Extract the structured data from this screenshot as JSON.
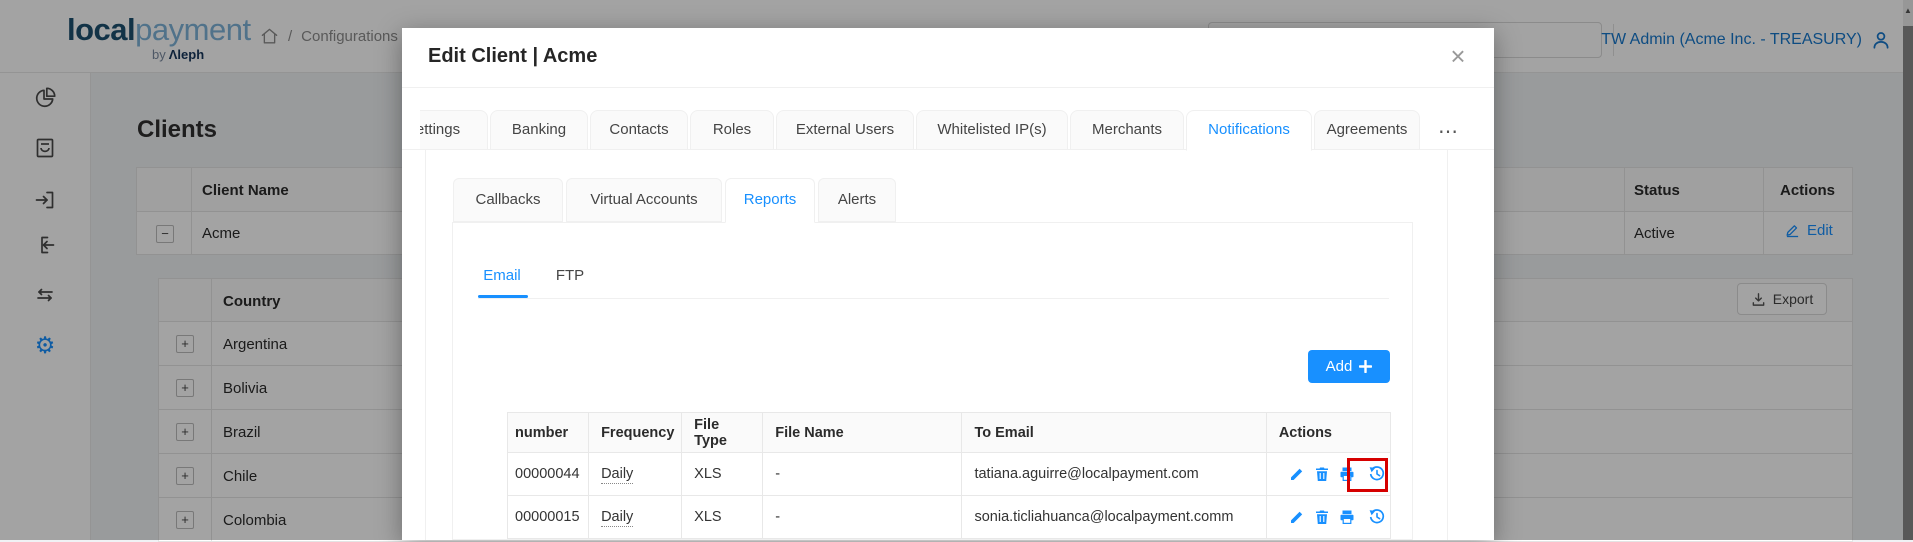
{
  "colors": {
    "accent": "#1890ff",
    "annotation_red": "#d60000",
    "logo_dark": "#1d506f",
    "logo_light": "#7db2d8",
    "brand_navy": "#16365c",
    "user_link": "#1677cc"
  },
  "header": {
    "logo_local": "local",
    "logo_payment": "payment",
    "logo_by": "by",
    "logo_brand": "Λleph",
    "breadcrumb_separator": "/",
    "breadcrumb_item": "Configurations",
    "search_value": "",
    "user_label": "TW Admin (Acme Inc. - TREASURY)",
    "scroll_up_arrow": "▲"
  },
  "sidebar": {
    "icons": [
      "pie-chart-icon",
      "documents-icon",
      "pay-in-icon",
      "pay-out-icon",
      "swap-icon",
      "gear-icon"
    ],
    "gear_glyph": "⚙"
  },
  "page": {
    "title": "Clients",
    "clients_table": {
      "columns": [
        "Client Name",
        "Status",
        "Actions"
      ],
      "row": {
        "expand": "−",
        "name": "Acme",
        "status": "Active",
        "edit_label": "Edit"
      },
      "countries": {
        "column": "Country",
        "export_label": "Export",
        "expand": "+",
        "rows": [
          "Argentina",
          "Bolivia",
          "Brazil",
          "Chile",
          "Colombia"
        ]
      }
    }
  },
  "modal": {
    "title": "Edit Client | Acme",
    "close": "×",
    "tabs": [
      "Settings",
      "Banking",
      "Contacts",
      "Roles",
      "External Users",
      "Whitelisted IP(s)",
      "Merchants",
      "Notifications",
      "Agreements"
    ],
    "active_tab": "Notifications",
    "more": "⋯",
    "subtabs": [
      "Callbacks",
      "Virtual Accounts",
      "Reports",
      "Alerts"
    ],
    "active_subtab": "Reports",
    "channel_tabs": [
      "Email",
      "FTP"
    ],
    "active_channel": "Email",
    "add_label": "Add",
    "report_table": {
      "columns": [
        "number",
        "Frequency",
        "File Type",
        "File Name",
        "To Email",
        "Actions"
      ],
      "rows": [
        {
          "number": "00000044",
          "frequency": "Daily",
          "file_type": "XLS",
          "file_name": "-",
          "to_email": "tatiana.aguirre@localpayment.com"
        },
        {
          "number": "00000015",
          "frequency": "Daily",
          "file_type": "XLS",
          "file_name": "-",
          "to_email": "sonia.ticliahuanca@localpayment.comm"
        }
      ],
      "action_icons": [
        "edit-pencil",
        "delete-trash",
        "print",
        "history-restore"
      ]
    },
    "annotation": {
      "highlighted_icon": "history-restore",
      "row_number": "00000044"
    }
  }
}
